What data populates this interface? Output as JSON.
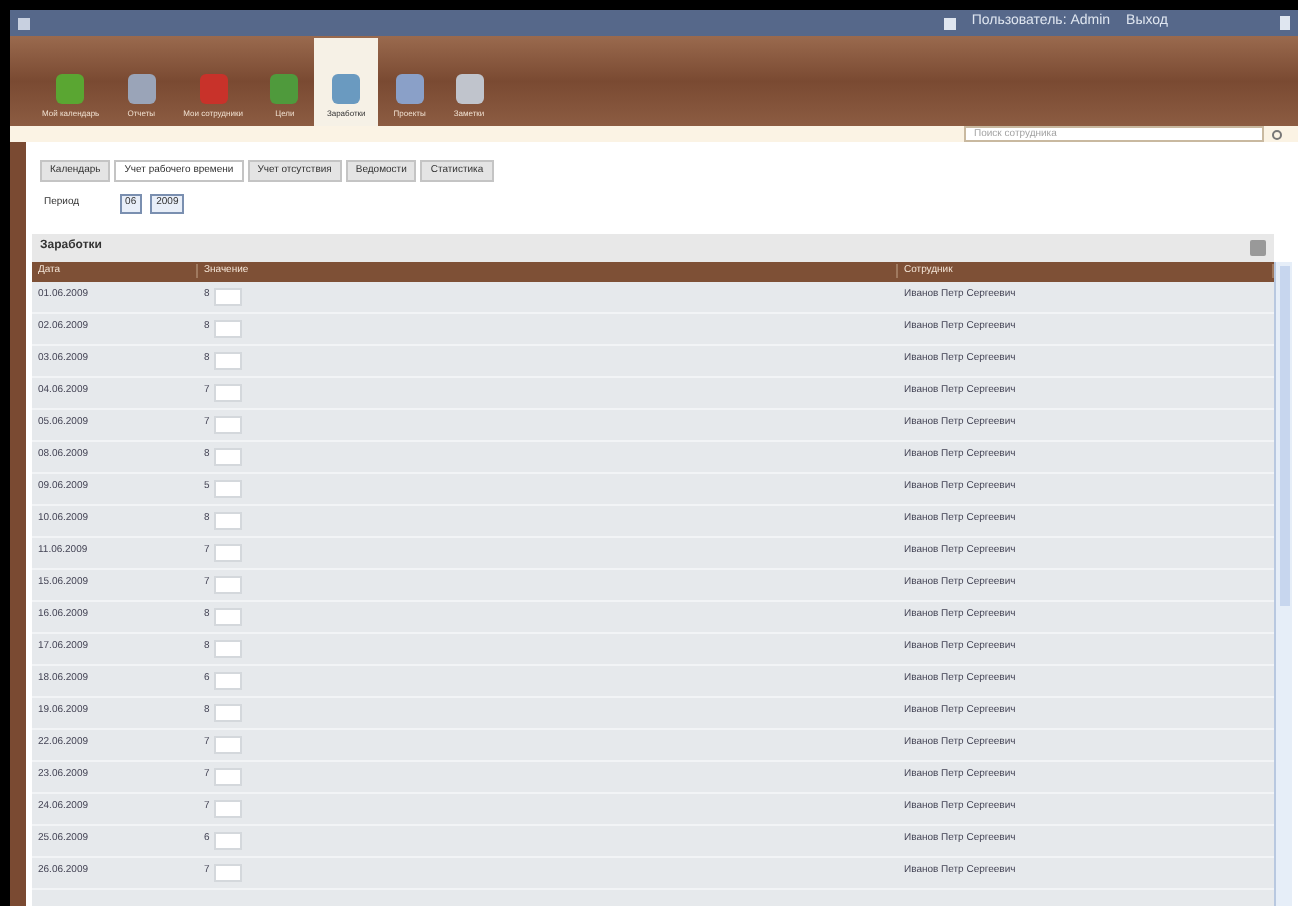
{
  "top_bar": {
    "user": "Пользователь: Admin",
    "logout": "Выход"
  },
  "toolbar": [
    {
      "label": "Мой календарь",
      "selected": false,
      "color": "#5aa632"
    },
    {
      "label": "Отчеты",
      "selected": false,
      "color": "#9aa4b8"
    },
    {
      "label": "Мои сотрудники",
      "selected": false,
      "color": "#c8322a"
    },
    {
      "label": "Цели",
      "selected": false,
      "color": "#4f9a3c"
    },
    {
      "label": "Заработки",
      "selected": true,
      "color": "#6a9ac0"
    },
    {
      "label": "Проекты",
      "selected": false,
      "color": "#8aa0c8"
    },
    {
      "label": "Заметки",
      "selected": false,
      "color": "#c0c4cc"
    }
  ],
  "search": {
    "placeholder": "Поиск сотрудника"
  },
  "tabs": [
    {
      "label": "Календарь",
      "selected": false
    },
    {
      "label": "Учет рабочего времени",
      "selected": true
    },
    {
      "label": "Учет отсутствия",
      "selected": false
    },
    {
      "label": "Ведомости",
      "selected": false
    },
    {
      "label": "Статистика",
      "selected": false
    }
  ],
  "filter": {
    "label": "Период",
    "month": "06",
    "year": "2009"
  },
  "section": {
    "title": "Заработки"
  },
  "table": {
    "columns": [
      "Дата",
      "Значение",
      "Сотрудник"
    ],
    "rows": [
      [
        "01.06.2009",
        "8",
        "Иванов Петр Сергеевич"
      ],
      [
        "02.06.2009",
        "8",
        "Иванов Петр Сергеевич"
      ],
      [
        "03.06.2009",
        "8",
        "Иванов Петр Сергеевич"
      ],
      [
        "04.06.2009",
        "7",
        "Иванов Петр Сергеевич"
      ],
      [
        "05.06.2009",
        "7",
        "Иванов Петр Сергеевич"
      ],
      [
        "08.06.2009",
        "8",
        "Иванов Петр Сергеевич"
      ],
      [
        "09.06.2009",
        "5",
        "Иванов Петр Сергеевич"
      ],
      [
        "10.06.2009",
        "8",
        "Иванов Петр Сергеевич"
      ],
      [
        "11.06.2009",
        "7",
        "Иванов Петр Сергеевич"
      ],
      [
        "15.06.2009",
        "7",
        "Иванов Петр Сергеевич"
      ],
      [
        "16.06.2009",
        "8",
        "Иванов Петр Сергеевич"
      ],
      [
        "17.06.2009",
        "8",
        "Иванов Петр Сергеевич"
      ],
      [
        "18.06.2009",
        "6",
        "Иванов Петр Сергеевич"
      ],
      [
        "19.06.2009",
        "8",
        "Иванов Петр Сергеевич"
      ],
      [
        "22.06.2009",
        "7",
        "Иванов Петр Сергеевич"
      ],
      [
        "23.06.2009",
        "7",
        "Иванов Петр Сергеевич"
      ],
      [
        "24.06.2009",
        "7",
        "Иванов Петр Сергеевич"
      ],
      [
        "25.06.2009",
        "6",
        "Иванов Петр Сергеевич"
      ],
      [
        "26.06.2009",
        "7",
        "Иванов Петр Сергеевич"
      ]
    ]
  }
}
